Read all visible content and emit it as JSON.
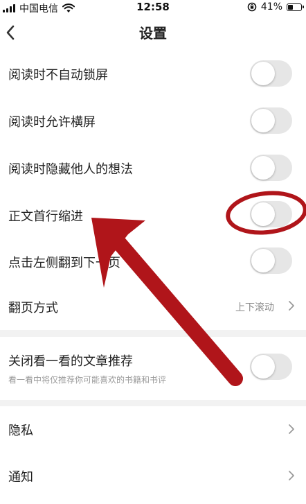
{
  "status_bar": {
    "carrier": "中国电信",
    "time": "12:58",
    "battery": "41%",
    "battery_level": 0.41
  },
  "header": {
    "title": "设置",
    "back_icon": "chevron-left-icon"
  },
  "settings": {
    "lock_screen": {
      "label": "阅读时不自动锁屏",
      "on": false
    },
    "landscape": {
      "label": "阅读时允许横屏",
      "on": false
    },
    "hide_thoughts": {
      "label": "阅读时隐藏他人的想法",
      "on": false
    },
    "indent": {
      "label": "正文首行缩进",
      "on": false
    },
    "tap_left": {
      "label": "点击左侧翻到下一页",
      "on": false
    },
    "page_turn": {
      "label": "翻页方式",
      "value": "上下滚动"
    },
    "recommend": {
      "label": "关闭看一看的文章推荐",
      "sub": "看一看中将仅推荐你可能喜欢的书籍和书评",
      "on": false
    },
    "privacy": {
      "label": "隐私"
    },
    "notify": {
      "label": "通知"
    }
  },
  "colors": {
    "annotation": "#b0151a",
    "toggle_off": "#e6e6e6",
    "section_gap": "#f2f2f2"
  }
}
